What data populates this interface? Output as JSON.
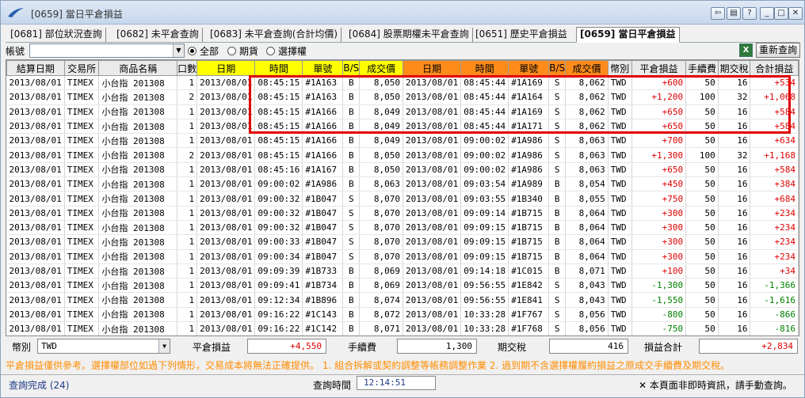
{
  "window": {
    "title": "[0659] 當日平倉損益"
  },
  "tabs": [
    {
      "label": "[0681] 部位狀況查詢"
    },
    {
      "label": "[0682] 未平倉查詢"
    },
    {
      "label": "[0683] 未平倉查詢(合計均價)"
    },
    {
      "label": "[0684] 股票期權未平倉查詢"
    },
    {
      "label": "[0651] 歷史平倉損益"
    },
    {
      "label": "[0659] 當日平倉損益"
    }
  ],
  "toolbar": {
    "account_label": "帳號",
    "account_value": "",
    "radios": [
      {
        "label": "全部",
        "checked": true
      },
      {
        "label": "期貨",
        "checked": false
      },
      {
        "label": "選擇權",
        "checked": false
      }
    ],
    "refresh_label": "重新查詢",
    "excel_icon": "excel-icon"
  },
  "table": {
    "headers": [
      "結算日期",
      "交易所",
      "商品名稱",
      "口數",
      "日期",
      "時間",
      "單號",
      "B/S",
      "成交價",
      "日期",
      "時間",
      "單號",
      "B/S",
      "成交價",
      "幣別",
      "平倉損益",
      "手續費",
      "期交稅",
      "合計損益"
    ],
    "rows": [
      [
        "2013/08/01",
        "TIMEX",
        "小台指 201308",
        "1",
        "2013/08/01",
        "08:45:15",
        "#1A163",
        "B",
        "8,050",
        "2013/08/01",
        "08:45:44",
        "#1A169",
        "S",
        "8,062",
        "TWD",
        "+600",
        "50",
        "16",
        "+534"
      ],
      [
        "2013/08/01",
        "TIMEX",
        "小台指 201308",
        "2",
        "2013/08/01",
        "08:45:15",
        "#1A163",
        "B",
        "8,050",
        "2013/08/01",
        "08:45:44",
        "#1A164",
        "S",
        "8,062",
        "TWD",
        "+1,200",
        "100",
        "32",
        "+1,068"
      ],
      [
        "2013/08/01",
        "TIMEX",
        "小台指 201308",
        "1",
        "2013/08/01",
        "08:45:15",
        "#1A166",
        "B",
        "8,049",
        "2013/08/01",
        "08:45:44",
        "#1A169",
        "S",
        "8,062",
        "TWD",
        "+650",
        "50",
        "16",
        "+584"
      ],
      [
        "2013/08/01",
        "TIMEX",
        "小台指 201308",
        "1",
        "2013/08/01",
        "08:45:15",
        "#1A166",
        "B",
        "8,049",
        "2013/08/01",
        "08:45:44",
        "#1A171",
        "S",
        "8,062",
        "TWD",
        "+650",
        "50",
        "16",
        "+584"
      ],
      [
        "2013/08/01",
        "TIMEX",
        "小台指 201308",
        "1",
        "2013/08/01",
        "08:45:15",
        "#1A166",
        "B",
        "8,049",
        "2013/08/01",
        "09:00:02",
        "#1A986",
        "S",
        "8,063",
        "TWD",
        "+700",
        "50",
        "16",
        "+634"
      ],
      [
        "2013/08/01",
        "TIMEX",
        "小台指 201308",
        "2",
        "2013/08/01",
        "08:45:15",
        "#1A166",
        "B",
        "8,050",
        "2013/08/01",
        "09:00:02",
        "#1A986",
        "S",
        "8,063",
        "TWD",
        "+1,300",
        "100",
        "32",
        "+1,168"
      ],
      [
        "2013/08/01",
        "TIMEX",
        "小台指 201308",
        "1",
        "2013/08/01",
        "08:45:16",
        "#1A167",
        "B",
        "8,050",
        "2013/08/01",
        "09:00:02",
        "#1A986",
        "S",
        "8,063",
        "TWD",
        "+650",
        "50",
        "16",
        "+584"
      ],
      [
        "2013/08/01",
        "TIMEX",
        "小台指 201308",
        "1",
        "2013/08/01",
        "09:00:02",
        "#1A986",
        "B",
        "8,063",
        "2013/08/01",
        "09:03:54",
        "#1A989",
        "B",
        "8,054",
        "TWD",
        "+450",
        "50",
        "16",
        "+384"
      ],
      [
        "2013/08/01",
        "TIMEX",
        "小台指 201308",
        "1",
        "2013/08/01",
        "09:00:32",
        "#1B047",
        "S",
        "8,070",
        "2013/08/01",
        "09:03:55",
        "#1B340",
        "B",
        "8,055",
        "TWD",
        "+750",
        "50",
        "16",
        "+684"
      ],
      [
        "2013/08/01",
        "TIMEX",
        "小台指 201308",
        "1",
        "2013/08/01",
        "09:00:32",
        "#1B047",
        "S",
        "8,070",
        "2013/08/01",
        "09:09:14",
        "#1B715",
        "B",
        "8,064",
        "TWD",
        "+300",
        "50",
        "16",
        "+234"
      ],
      [
        "2013/08/01",
        "TIMEX",
        "小台指 201308",
        "1",
        "2013/08/01",
        "09:00:32",
        "#1B047",
        "S",
        "8,070",
        "2013/08/01",
        "09:09:15",
        "#1B715",
        "B",
        "8,064",
        "TWD",
        "+300",
        "50",
        "16",
        "+234"
      ],
      [
        "2013/08/01",
        "TIMEX",
        "小台指 201308",
        "1",
        "2013/08/01",
        "09:00:33",
        "#1B047",
        "S",
        "8,070",
        "2013/08/01",
        "09:09:15",
        "#1B715",
        "B",
        "8,064",
        "TWD",
        "+300",
        "50",
        "16",
        "+234"
      ],
      [
        "2013/08/01",
        "TIMEX",
        "小台指 201308",
        "1",
        "2013/08/01",
        "09:00:34",
        "#1B047",
        "S",
        "8,070",
        "2013/08/01",
        "09:09:15",
        "#1B715",
        "B",
        "8,064",
        "TWD",
        "+300",
        "50",
        "16",
        "+234"
      ],
      [
        "2013/08/01",
        "TIMEX",
        "小台指 201308",
        "1",
        "2013/08/01",
        "09:09:39",
        "#1B733",
        "B",
        "8,069",
        "2013/08/01",
        "09:14:18",
        "#1C015",
        "B",
        "8,071",
        "TWD",
        "+100",
        "50",
        "16",
        "+34"
      ],
      [
        "2013/08/01",
        "TIMEX",
        "小台指 201308",
        "1",
        "2013/08/01",
        "09:09:41",
        "#1B734",
        "B",
        "8,069",
        "2013/08/01",
        "09:56:55",
        "#1E842",
        "S",
        "8,043",
        "TWD",
        "-1,300",
        "50",
        "16",
        "-1,366"
      ],
      [
        "2013/08/01",
        "TIMEX",
        "小台指 201308",
        "1",
        "2013/08/01",
        "09:12:34",
        "#1B896",
        "B",
        "8,074",
        "2013/08/01",
        "09:56:55",
        "#1E841",
        "S",
        "8,043",
        "TWD",
        "-1,550",
        "50",
        "16",
        "-1,616"
      ],
      [
        "2013/08/01",
        "TIMEX",
        "小台指 201308",
        "1",
        "2013/08/01",
        "09:16:22",
        "#1C143",
        "B",
        "8,072",
        "2013/08/01",
        "10:33:28",
        "#1F767",
        "S",
        "8,056",
        "TWD",
        "-800",
        "50",
        "16",
        "-866"
      ],
      [
        "2013/08/01",
        "TIMEX",
        "小台指 201308",
        "1",
        "2013/08/01",
        "09:16:22",
        "#1C142",
        "B",
        "8,071",
        "2013/08/01",
        "10:33:28",
        "#1F768",
        "S",
        "8,056",
        "TWD",
        "-750",
        "50",
        "16",
        "-816"
      ]
    ]
  },
  "summary": {
    "currency_label": "幣別",
    "currency_value": "TWD",
    "pnl_label": "平倉損益",
    "pnl_value": "+4,550",
    "fee_label": "手續費",
    "fee_value": "1,300",
    "tax_label": "期交稅",
    "tax_value": "416",
    "total_label": "損益合計",
    "total_value": "+2,834"
  },
  "notice": "平倉損益僅供參考。選擇權部位如過下列情形，交易成本將無法正確提供。  1. 組合拆解或契約調整等帳務調整作業  2. 過到期不含選擇權履約損益之原成交手續費及期交稅。",
  "statusbar": {
    "left": "查詢完成 (24)",
    "query_time_label": "查詢時間",
    "query_time_value": "12:14:51",
    "right": "本頁面非即時資訊，請手動查詢。"
  },
  "colors": {
    "positive": "#e00000",
    "negative": "#008000",
    "highlight": "#e00000",
    "notice": "#ff8c00"
  }
}
